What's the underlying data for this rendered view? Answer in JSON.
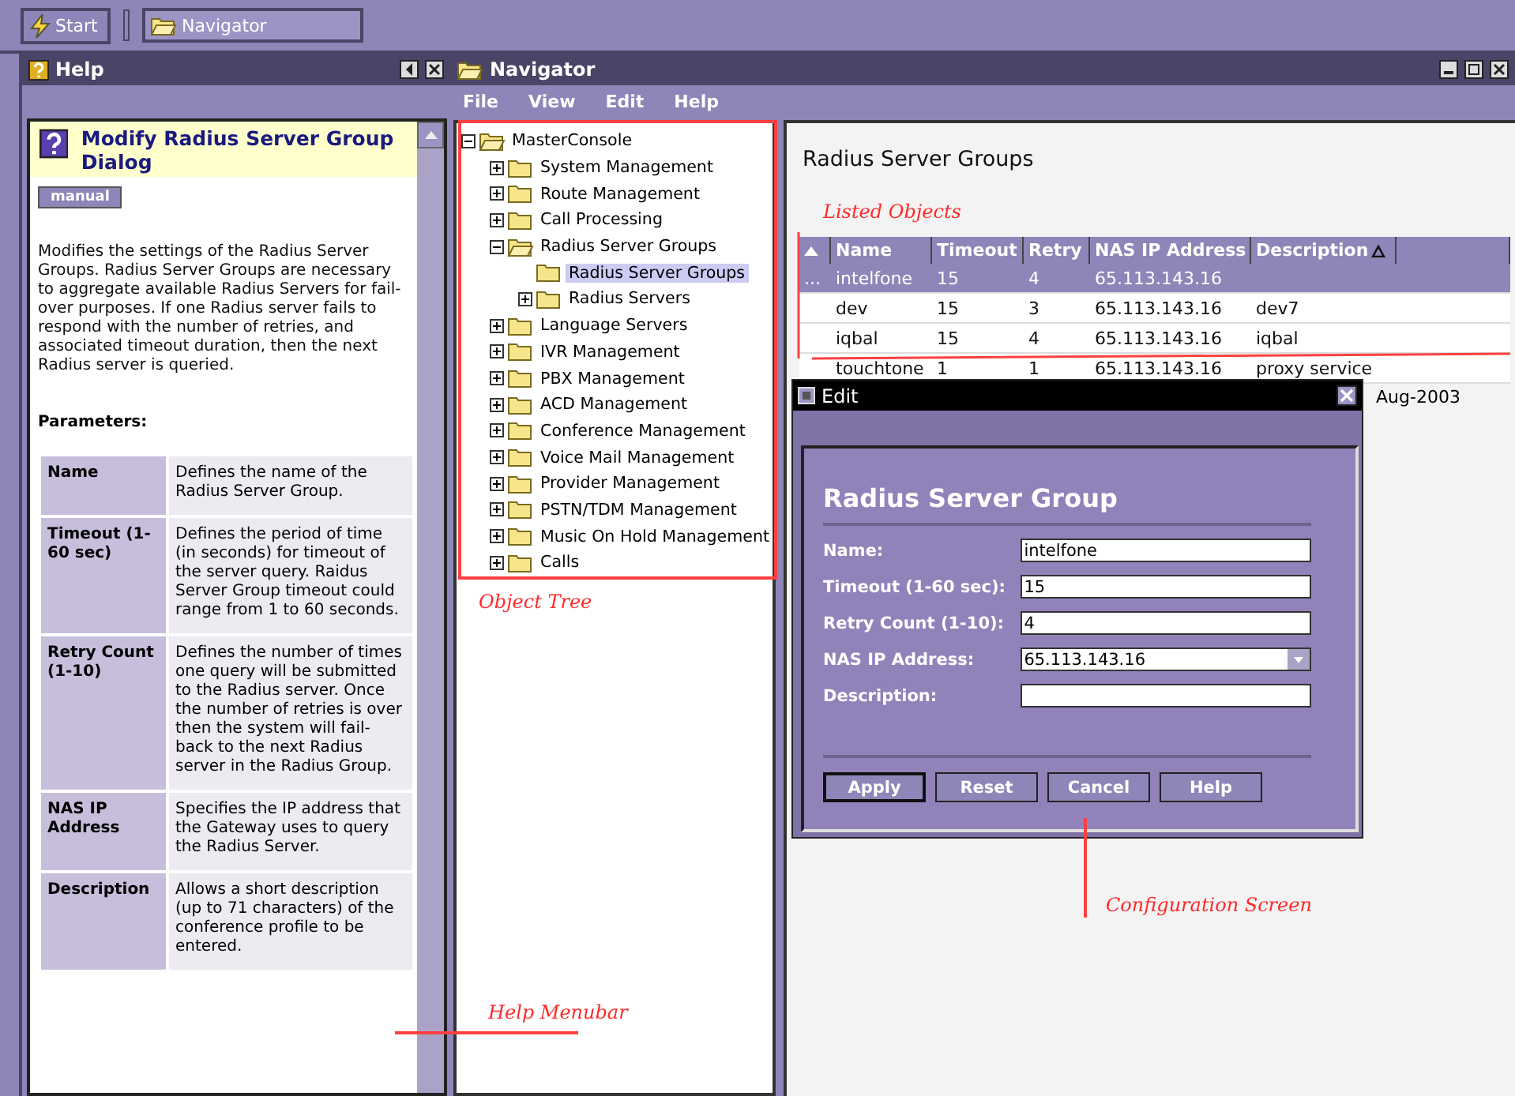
{
  "taskbar": {
    "start": "Start",
    "tasks": [
      {
        "label": "Navigator",
        "selected": false
      }
    ]
  },
  "help": {
    "title": "Help",
    "heading": "Modify Radius Server Group Dialog",
    "manual_button": "manual",
    "description": "Modifies the settings of the Radius Server Groups. Radius Server Groups are necessary to aggregate available Radius Servers for fail-over purposes. If one Radius server fails to respond with the number of retries, and associated timeout duration, then the next Radius server is queried.",
    "parameters_title": "Parameters:",
    "parameters": [
      {
        "name": "Name",
        "description": "Defines the name of the Radius Server Group."
      },
      {
        "name": "Timeout (1-60 sec)",
        "description": "Defines the period of time (in seconds) for timeout of the server query. Raidus Server Group timeout could range from 1 to 60 seconds."
      },
      {
        "name": "Retry Count (1-10)",
        "description": "Defines the number of times one query will be submitted to the Radius server. Once the number of retries is over then the system will fail-back to the next Radius server in the Radius Group."
      },
      {
        "name": "NAS IP Address",
        "description": "Specifies the IP address that the Gateway uses to query the Radius Server."
      },
      {
        "name": "Description",
        "description": "Allows a short description (up to 71 characters) of the conference profile to be entered."
      }
    ]
  },
  "navigator": {
    "title": "Navigator",
    "menu": [
      "File",
      "View",
      "Edit",
      "Help"
    ],
    "tree": [
      {
        "label": "MasterConsole",
        "expanded": true,
        "selected": false,
        "children": [
          {
            "label": "System Management",
            "expanded": false,
            "selected": false
          },
          {
            "label": "Route Management",
            "expanded": false,
            "selected": false
          },
          {
            "label": "Call Processing",
            "expanded": false,
            "selected": false
          },
          {
            "label": "Radius Server Groups",
            "expanded": true,
            "selected": false,
            "children": [
              {
                "label": "Radius Server Groups",
                "selected": true
              },
              {
                "label": "Radius Servers",
                "expanded": false,
                "selected": false
              }
            ]
          },
          {
            "label": "Language Servers",
            "expanded": false,
            "selected": false
          },
          {
            "label": "IVR Management",
            "expanded": false,
            "selected": false
          },
          {
            "label": "PBX Management",
            "expanded": false,
            "selected": false
          },
          {
            "label": "ACD Management",
            "expanded": false,
            "selected": false
          },
          {
            "label": "Conference Management",
            "expanded": false,
            "selected": false
          },
          {
            "label": "Voice Mail Management",
            "expanded": false,
            "selected": false
          },
          {
            "label": "Provider Management",
            "expanded": false,
            "selected": false
          },
          {
            "label": "PSTN/TDM Management",
            "expanded": false,
            "selected": false
          },
          {
            "label": "Music On Hold Management",
            "expanded": false,
            "selected": false
          },
          {
            "label": "Calls",
            "expanded": false,
            "selected": false
          }
        ]
      }
    ],
    "content": {
      "title": "Radius Server Groups",
      "columns": [
        {
          "label": "Name",
          "sorted": false
        },
        {
          "label": "Timeout",
          "sorted": false
        },
        {
          "label": "Retry",
          "sorted": false
        },
        {
          "label": "NAS IP Address",
          "sorted": false
        },
        {
          "label": "Description",
          "sorted": true
        }
      ],
      "rows": [
        {
          "marker": "...",
          "cells": [
            "intelfone",
            "15",
            "4",
            "65.113.143.16",
            ""
          ],
          "selected": true
        },
        {
          "cells": [
            "dev",
            "15",
            "3",
            "65.113.143.16",
            "dev7"
          ],
          "selected": false
        },
        {
          "cells": [
            "iqbal",
            "15",
            "4",
            "65.113.143.16",
            "iqbal"
          ],
          "selected": false
        },
        {
          "cells": [
            "touchtone",
            "1",
            "1",
            "65.113.143.16",
            "proxy service"
          ],
          "selected": false
        }
      ],
      "partial_text": "Aug-2003"
    }
  },
  "edit_dialog": {
    "title": "Edit",
    "heading": "Radius Server Group",
    "fields": [
      {
        "kind": "text",
        "label": "Name:",
        "value": "intelfone"
      },
      {
        "kind": "text",
        "label": "Timeout (1-60 sec):",
        "value": "15"
      },
      {
        "kind": "text",
        "label": "Retry Count (1-10):",
        "value": "4"
      },
      {
        "kind": "dropdown",
        "label": "NAS IP Address:",
        "value": "65.113.143.16"
      },
      {
        "kind": "text",
        "label": "Description:"
      }
    ],
    "buttons": [
      {
        "label": "Apply",
        "default": true
      },
      {
        "label": "Reset",
        "default": false
      },
      {
        "label": "Cancel",
        "default": false
      },
      {
        "label": "Help",
        "default": false
      }
    ]
  },
  "annotations": [
    {
      "kind": "frame",
      "text": "Object Tree"
    },
    {
      "kind": "bracket",
      "text": "Listed Objects"
    },
    {
      "kind": "vertical",
      "text": "Configuration Screen"
    },
    {
      "kind": "horizontal",
      "text": "Help Menubar"
    }
  ]
}
